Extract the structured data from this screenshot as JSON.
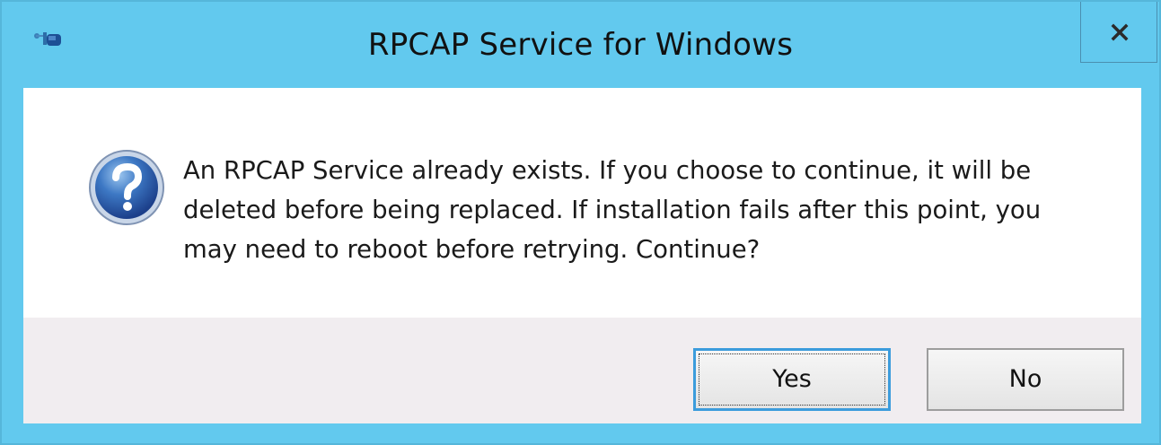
{
  "window": {
    "title": "RPCAP Service for Windows",
    "app_icon": "app-icon",
    "close_icon": "close-icon"
  },
  "message": {
    "icon": "question-icon",
    "text": "An RPCAP Service already exists. If you choose to continue, it will be\ndeleted before being replaced.  If installation fails after this point, you\nmay need to reboot before retrying.  Continue?"
  },
  "buttons": {
    "yes_label": "Yes",
    "no_label": "No"
  },
  "colors": {
    "title_bar": "#62c9ee",
    "content_bg": "#ffffff",
    "footer_bg": "#f1edf0",
    "primary_border": "#3c9cdc"
  }
}
